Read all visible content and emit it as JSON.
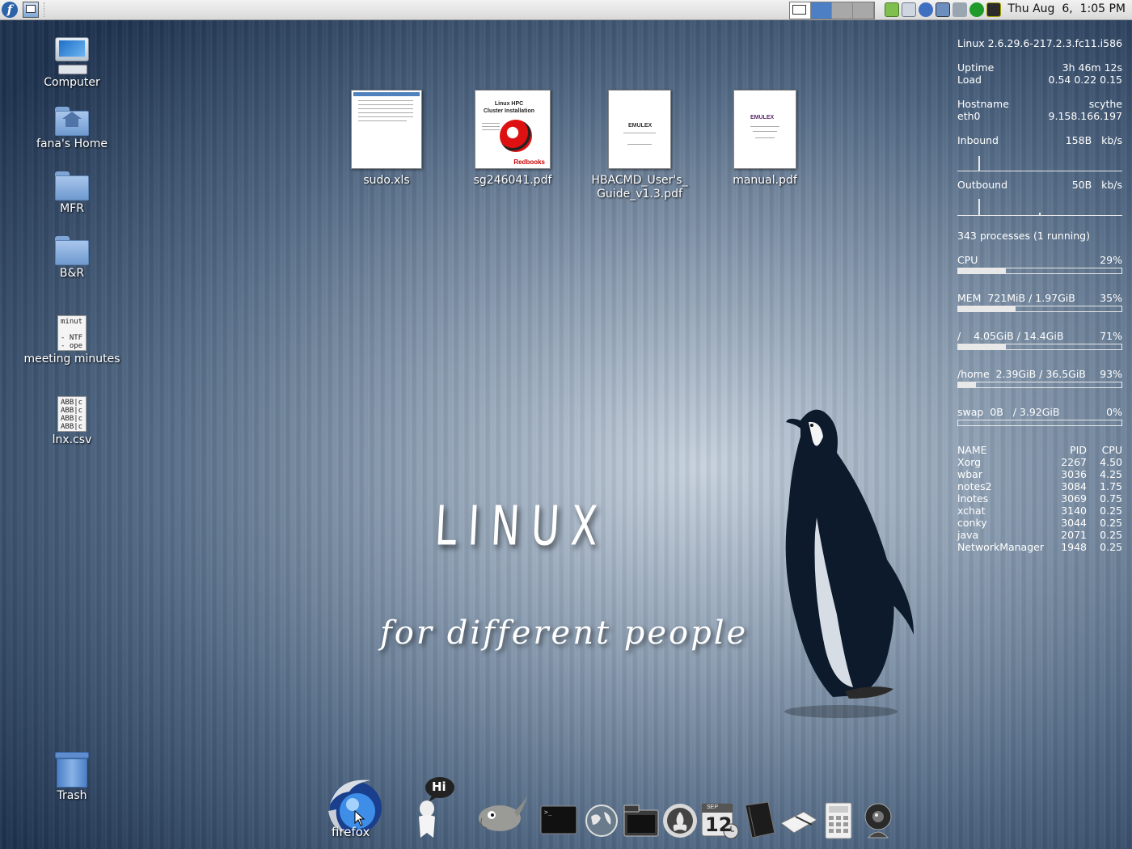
{
  "top_panel": {
    "clock": "Thu Aug  6,  1:05 PM",
    "workspaces": 4,
    "active_workspace": 2
  },
  "desktop": {
    "left_icons": [
      {
        "label": "Computer",
        "icon": "computer-icon"
      },
      {
        "label": "fana's Home",
        "icon": "home-folder-icon"
      },
      {
        "label": "MFR",
        "icon": "folder-icon"
      },
      {
        "label": "B&R",
        "icon": "folder-icon"
      },
      {
        "label": "meeting minutes",
        "icon": "text-file-icon",
        "preview": "minut\n\n- NTF\n- ope"
      },
      {
        "label": "lnx.csv",
        "icon": "csv-file-icon",
        "preview": "ABB|c\nABB|c\nABB|c\nABB|c"
      },
      {
        "label": "Trash",
        "icon": "trash-icon"
      }
    ],
    "documents": [
      {
        "label": "sudo.xls",
        "type": "spreadsheet"
      },
      {
        "label": "sg246041.pdf",
        "type": "pdf",
        "thumb_title": "Linux HPC\nCluster Installation",
        "thumb_brand": "Redbooks"
      },
      {
        "label": "HBACMD_User's_\nGuide_v1.3.pdf",
        "type": "pdf",
        "thumb_brand": "EMULEX"
      },
      {
        "label": "manual.pdf",
        "type": "pdf",
        "thumb_brand": "EMULEX"
      }
    ]
  },
  "wallpaper": {
    "title": "LINUX",
    "subtitle": "for different people"
  },
  "conky": {
    "kernel": "Linux 2.6.29.6-217.2.3.fc11.i586",
    "uptime_label": "Uptime",
    "uptime": "3h 46m 12s",
    "load_label": "Load",
    "load": "0.54 0.22 0.15",
    "hostname_label": "Hostname",
    "hostname": "scythe",
    "iface_label": "eth0",
    "ip": "9.158.166.197",
    "inbound_label": "Inbound",
    "inbound": "158B   kb/s",
    "outbound_label": "Outbound",
    "outbound": "50B   kb/s",
    "processes": "343 processes (1 running)",
    "cpu_label": "CPU",
    "cpu_pct": "29%",
    "cpu_fill": 0.29,
    "mem_label": "MEM  721MiB / 1.97GiB",
    "mem_pct": "35%",
    "mem_fill": 0.35,
    "root_label": "/    4.05GiB / 14.4GiB",
    "root_pct": "71%",
    "root_fill": 0.29,
    "home_label": "/home  2.39GiB / 36.5GiB",
    "home_pct": "93%",
    "home_fill": 0.11,
    "swap_label": "swap  0B   / 3.92GiB",
    "swap_pct": "0%",
    "swap_fill": 0.0,
    "proc_headers": [
      "NAME",
      "PID",
      "CPU"
    ],
    "procs": [
      [
        "Xorg",
        "2267",
        "4.50"
      ],
      [
        "wbar",
        "3036",
        "4.25"
      ],
      [
        "notes2",
        "3084",
        "1.75"
      ],
      [
        "lnotes",
        "3069",
        "0.75"
      ],
      [
        "xchat",
        "3140",
        "0.25"
      ],
      [
        "conky",
        "3044",
        "0.25"
      ],
      [
        "java",
        "2071",
        "0.25"
      ],
      [
        "NetworkManager",
        "1948",
        "0.25"
      ]
    ]
  },
  "dock": {
    "hover_label": "firefox",
    "chat_bubble": "Hi",
    "calendar_month": "SEP",
    "calendar_day": "12",
    "items": [
      "firefox-icon",
      "pidgin-icon",
      "gimp-icon",
      "terminal-icon",
      "globe-icon",
      "file-manager-icon",
      "burner-icon",
      "calendar-icon",
      "notebook-icon",
      "notepad-icon",
      "calculator-icon",
      "webcam-icon"
    ]
  }
}
